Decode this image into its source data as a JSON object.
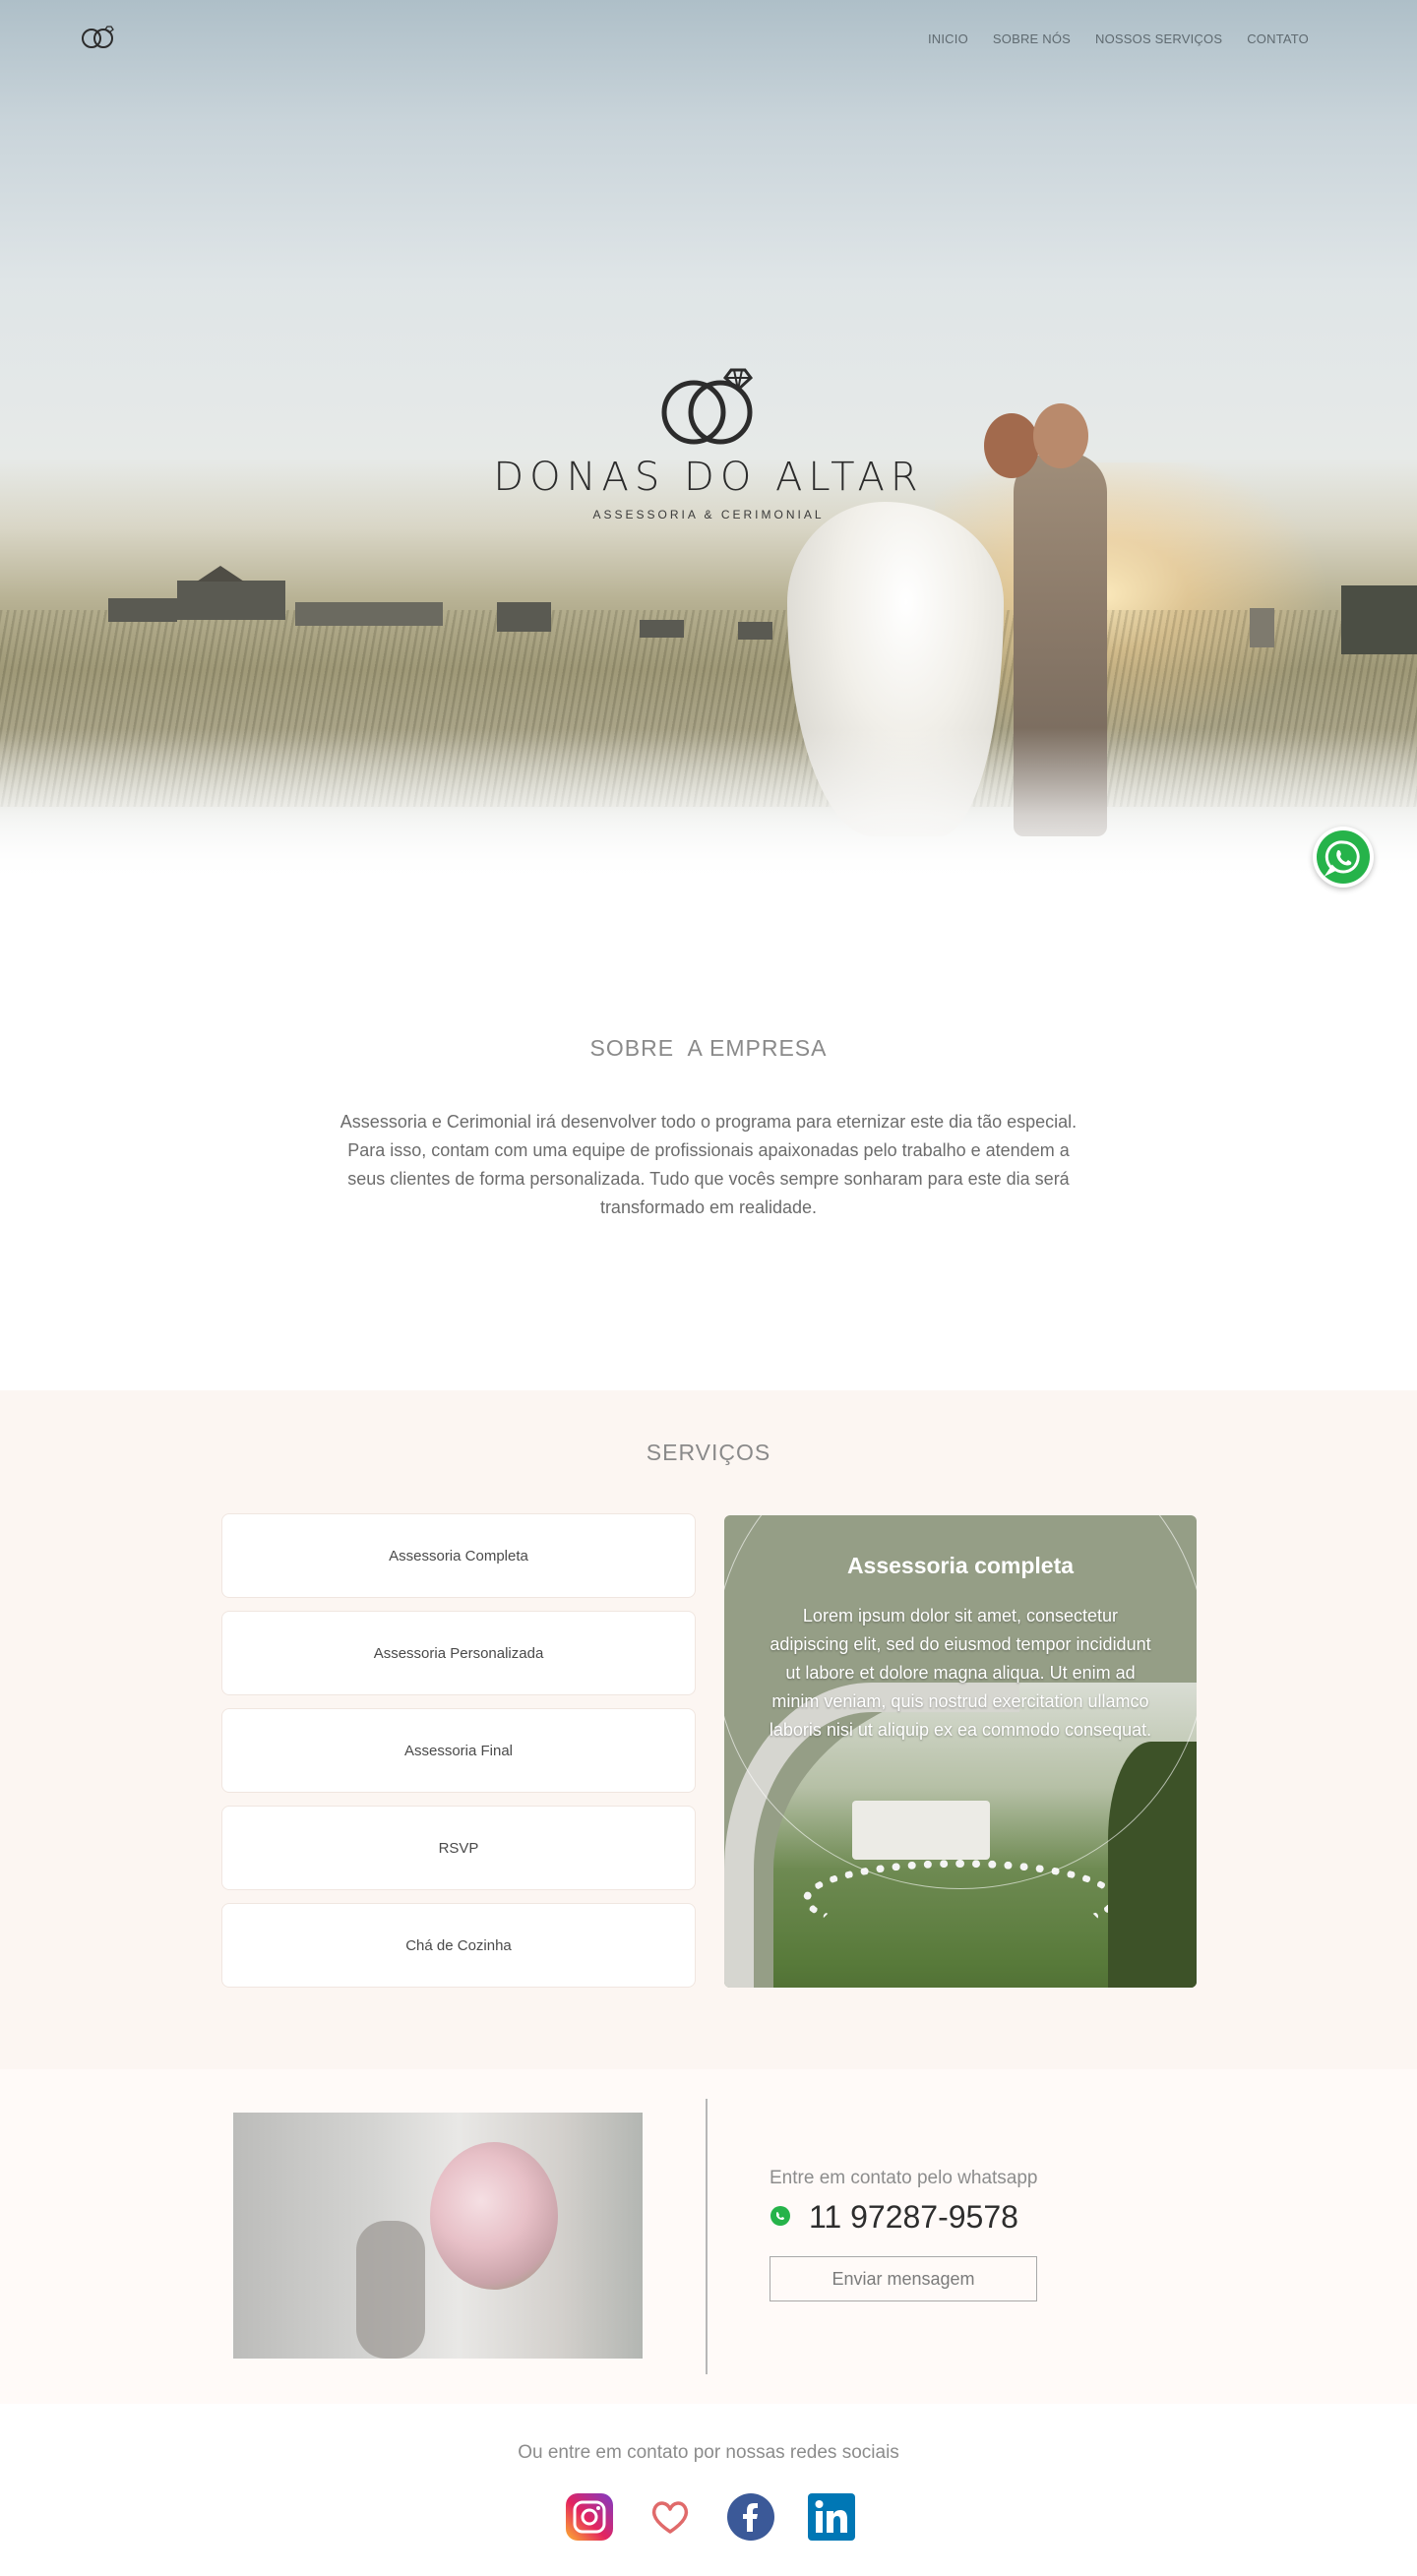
{
  "nav": {
    "items": [
      {
        "label": "INICIO"
      },
      {
        "label": "SOBRE NÓS"
      },
      {
        "label": "NOSSOS SERVIÇOS"
      },
      {
        "label": "CONTATO"
      }
    ]
  },
  "brand": {
    "name": "DONAS DO ALTAR",
    "subtitle": "ASSESSORIA & CERIMONIAL"
  },
  "sobre": {
    "title": "SOBRE  A EMPRESA",
    "text": "Assessoria e Cerimonial irá desenvolver todo o programa para eternizar este dia tão especial. Para isso, contam com uma equipe de profissionais apaixonadas pelo trabalho e atendem a seus clientes de forma personalizada. Tudo que vocês sempre sonharam para este dia será transformado em realidade."
  },
  "servicos": {
    "title": "SERVIÇOS",
    "items": [
      {
        "label": "Assessoria Completa"
      },
      {
        "label": "Assessoria Personalizada"
      },
      {
        "label": "Assessoria Final"
      },
      {
        "label": "RSVP"
      },
      {
        "label": "Chá de Cozinha"
      }
    ],
    "card": {
      "title": "Assessoria completa",
      "text": "Lorem ipsum dolor sit amet, consectetur adipiscing elit, sed do eiusmod tempor incididunt ut labore et dolore magna aliqua. Ut enim ad minim veniam, quis nostrud exercitation ullamco laboris nisi ut aliquip ex ea commodo consequat."
    }
  },
  "contato": {
    "label": "Entre em contato pelo whatsapp",
    "phone": "11 97287-9578",
    "button": "Enviar mensagem"
  },
  "social": {
    "title": "Ou entre em contato por nossas redes sociais",
    "icons": [
      "instagram-icon",
      "heart-icon",
      "facebook-icon",
      "linkedin-icon"
    ]
  },
  "colors": {
    "whatsapp": "#26b34a",
    "services_bg": "#fcf6f2",
    "card_bg": "#959e86",
    "instagram": "#d6249f",
    "facebook": "#3b5998",
    "linkedin": "#0077b5",
    "heart": "#e06a6a"
  }
}
